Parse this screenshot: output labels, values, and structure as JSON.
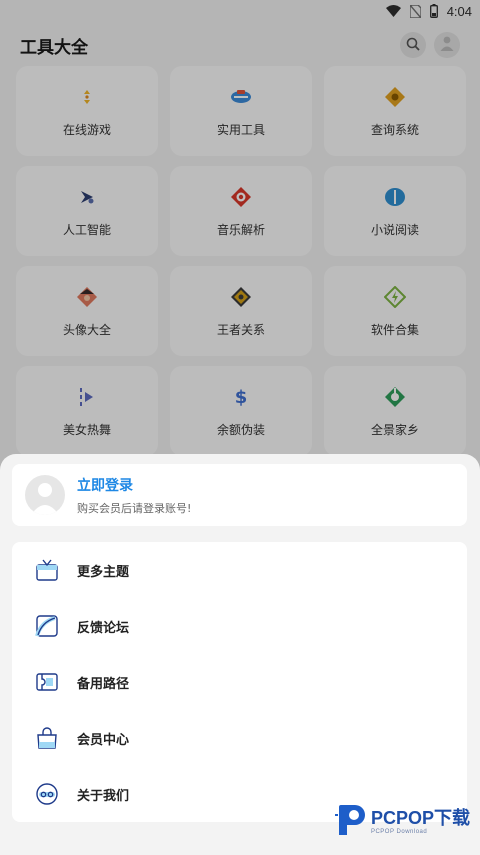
{
  "status_bar": {
    "time": "4:04",
    "icons": [
      "wifi-icon",
      "no-sim-icon",
      "battery-icon"
    ]
  },
  "app_bar": {
    "title": "工具大全",
    "actions": [
      "search-icon",
      "avatar-icon"
    ]
  },
  "grid": {
    "tiles": [
      {
        "label": "在线游戏",
        "icon": "game-icon",
        "color": "#f0b429"
      },
      {
        "label": "实用工具",
        "icon": "toolbox-icon",
        "color": "#3d8bd9"
      },
      {
        "label": "查询系统",
        "icon": "query-icon",
        "color": "#e0a020"
      },
      {
        "label": "人工智能",
        "icon": "ai-icon",
        "color": "#2c3e70"
      },
      {
        "label": "音乐解析",
        "icon": "music-icon",
        "color": "#d9372a"
      },
      {
        "label": "小说阅读",
        "icon": "book-icon",
        "color": "#2f8fd1"
      },
      {
        "label": "头像大全",
        "icon": "portrait-icon",
        "color": "#e07a5f"
      },
      {
        "label": "王者关系",
        "icon": "crest-icon",
        "color": "#d4a017"
      },
      {
        "label": "软件合集",
        "icon": "software-icon",
        "color": "#7cb342"
      },
      {
        "label": "美女热舞",
        "icon": "play-icon",
        "color": "#5c6bc0"
      },
      {
        "label": "余额伪装",
        "icon": "dollar-icon",
        "color": "#3f6fd1"
      },
      {
        "label": "全景家乡",
        "icon": "panorama-icon",
        "color": "#2e9e5b"
      }
    ]
  },
  "sheet": {
    "login": {
      "title": "立即登录",
      "subtitle": "购买会员后请登录账号!"
    },
    "menu": [
      {
        "label": "更多主题",
        "icon": "theme-icon"
      },
      {
        "label": "反馈论坛",
        "icon": "forum-icon"
      },
      {
        "label": "备用路径",
        "icon": "backup-route-icon"
      },
      {
        "label": "会员中心",
        "icon": "member-bag-icon"
      },
      {
        "label": "关于我们",
        "icon": "about-icon"
      }
    ]
  },
  "watermark": {
    "main": "PCPOP下载",
    "sub": "PCPOP Download"
  },
  "colors": {
    "accent": "#1e88e5",
    "sheet_bg": "#f3f3f3",
    "card_bg": "#ffffff",
    "watermark": "#1f4fa8"
  }
}
